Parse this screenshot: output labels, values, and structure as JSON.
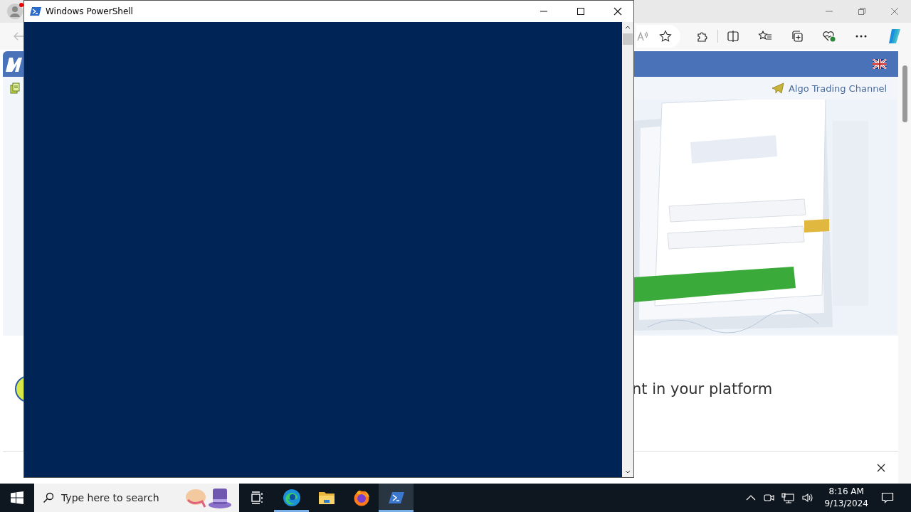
{
  "browser": {
    "channel_link": "Algo Trading Channel",
    "headline": "nt in your platform"
  },
  "powershell": {
    "title": "Windows PowerShell"
  },
  "taskbar": {
    "search": {
      "placeholder": "Type here to search"
    },
    "apps": [
      {
        "kind": "taskview",
        "selected": false,
        "running": false
      },
      {
        "kind": "edge",
        "selected": false,
        "running": true
      },
      {
        "kind": "explorer",
        "selected": false,
        "running": false
      },
      {
        "kind": "firefox",
        "selected": false,
        "running": false
      },
      {
        "kind": "powershell",
        "selected": true,
        "running": true
      }
    ],
    "clock": {
      "time": "8:16 AM",
      "date": "9/13/2024"
    }
  }
}
